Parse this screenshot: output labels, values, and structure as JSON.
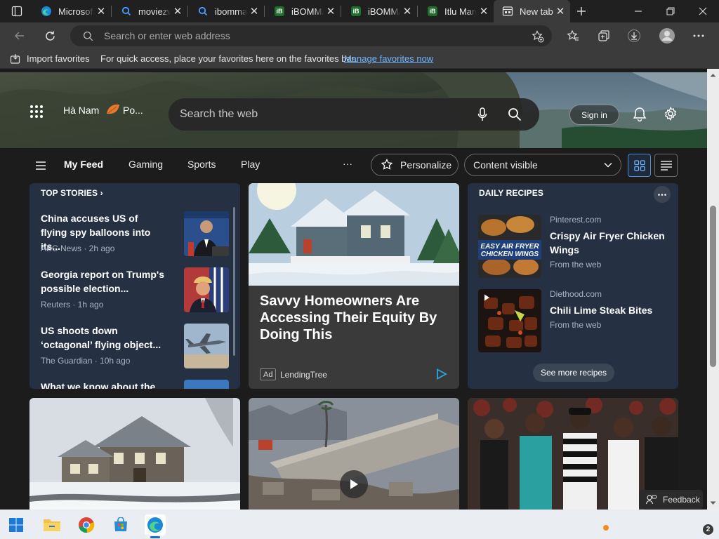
{
  "tabs": [
    {
      "label": "Microsoft",
      "icon": "edge-icon"
    },
    {
      "label": "moviezwap",
      "icon": "search-icon"
    },
    {
      "label": "ibomma",
      "icon": "search-icon"
    },
    {
      "label": "iBOMMA",
      "icon": "ibomma-icon"
    },
    {
      "label": "iBOMMA",
      "icon": "ibomma-icon"
    },
    {
      "label": "Itlu Maro",
      "icon": "ibomma-icon"
    },
    {
      "label": "New tab",
      "icon": "newtab-icon",
      "active": true
    }
  ],
  "address": {
    "placeholder": "Search or enter web address",
    "value": ""
  },
  "favorites_bar": {
    "import_label": "Import favorites",
    "hint": "For quick access, place your favorites here on the favorites bar.",
    "link": "Manage favorites now"
  },
  "hero": {
    "location": "Hà Nam",
    "weather_short": "Po...",
    "search_placeholder": "Search the web",
    "signin_label": "Sign in"
  },
  "feed_nav": {
    "tabs": [
      "My Feed",
      "Gaming",
      "Sports",
      "Play"
    ],
    "more": "···",
    "personalize": "Personalize",
    "content_visible": "Content visible"
  },
  "top_stories": {
    "title": "TOP STORIES",
    "items": [
      {
        "headline": "China accuses US of flying spy balloons into its...",
        "source": "ABC News · 2h ago"
      },
      {
        "headline": "Georgia report on Trump's possible election...",
        "source": "Reuters · 1h ago"
      },
      {
        "headline": "US shoots down ‘octagonal’ flying object...",
        "source": "The Guardian · 10h ago"
      },
      {
        "headline": "What we know about the",
        "source": ""
      }
    ]
  },
  "ad": {
    "title": "Savvy Homeowners Are Accessing Their Equity By Doing This",
    "badge": "Ad",
    "source": "LendingTree"
  },
  "daily_recipes": {
    "title": "DAILY RECIPES",
    "items": [
      {
        "source": "Pinterest.com",
        "title": "Crispy Air Fryer Chicken Wings",
        "from": "From the web",
        "thumb_caption": "EASY AIR FRYER CHICKEN WINGS"
      },
      {
        "source": "Diethood.com",
        "title": "Chili Lime Steak Bites",
        "from": "From the web"
      }
    ],
    "see_more": "See more recipes"
  },
  "feedback_label": "Feedback",
  "taskbar": {
    "notification_count": "2"
  }
}
